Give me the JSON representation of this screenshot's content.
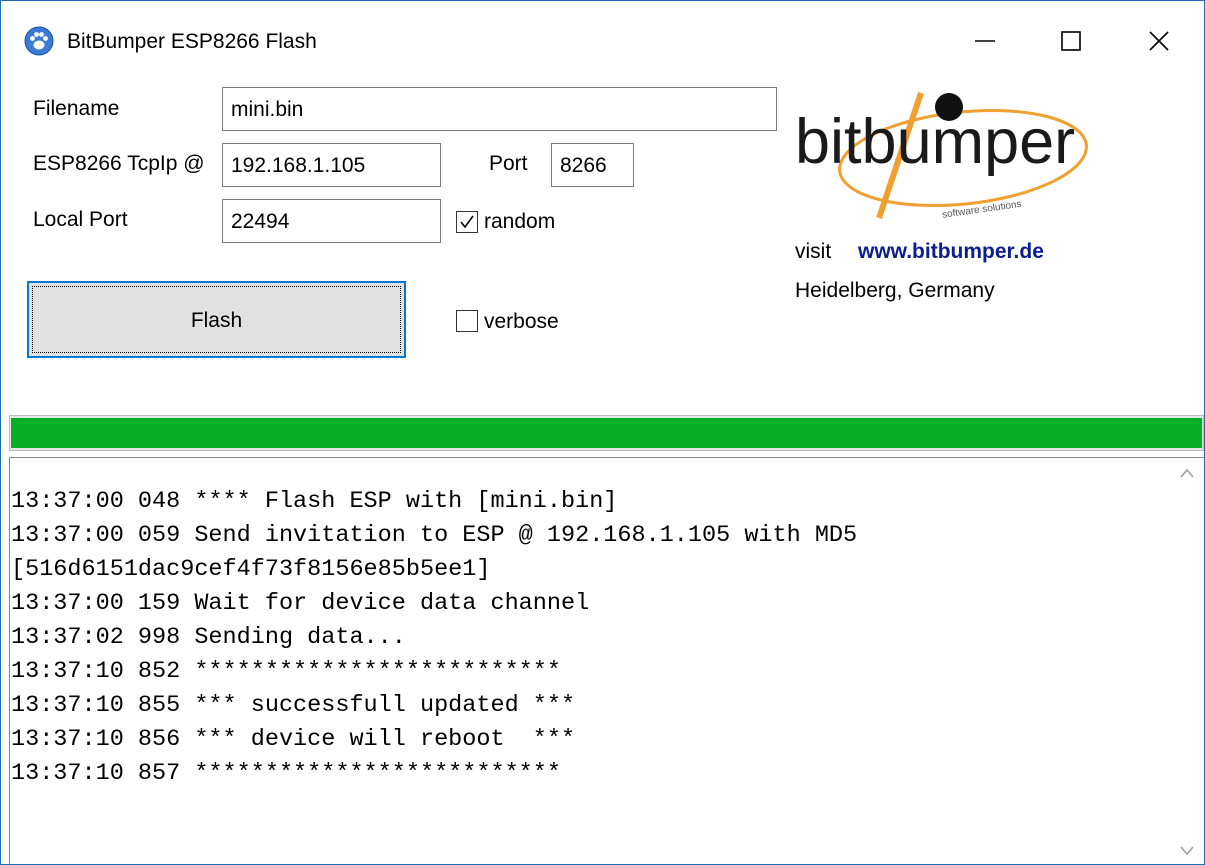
{
  "window": {
    "title": "BitBumper ESP8266 Flash"
  },
  "form": {
    "filename_label": "Filename",
    "filename_value": "mini.bin",
    "ip_label": "ESP8266 TcpIp @",
    "ip_value": "192.168.1.105",
    "port_label": "Port",
    "port_value": "8266",
    "local_port_label": "Local Port",
    "local_port_value": "22494",
    "random_label": "random",
    "random_checked": true,
    "verbose_label": "verbose",
    "verbose_checked": false,
    "flash_button_label": "Flash"
  },
  "branding": {
    "logo_text": "bitbumper",
    "logo_tagline": "software solutions",
    "visit_label": "visit",
    "url": "www.bitbumper.de",
    "location": "Heidelberg, Germany",
    "colors": {
      "logo_text": "#1a1a1a",
      "orbit": "#f0a030",
      "url": "#0a1e8f"
    }
  },
  "progress": {
    "value_percent": 100,
    "color": "#06b025"
  },
  "log": {
    "lines": [
      "13:37:00 048 **** Flash ESP with [mini.bin]",
      "13:37:00 059 Send invitation to ESP @ 192.168.1.105 with MD5",
      "[516d6151dac9cef4f73f8156e85b5ee1]",
      "13:37:00 159 Wait for device data channel",
      "13:37:02 998 Sending data...",
      "13:37:10 852 **************************",
      "13:37:10 855 *** successfull updated ***",
      "13:37:10 856 *** device will reboot  ***",
      "13:37:10 857 **************************"
    ]
  },
  "icons": {
    "app": "paw-icon",
    "minimize": "minimize-icon",
    "maximize": "maximize-icon",
    "close": "close-icon",
    "scroll_up": "chevron-up-icon",
    "scroll_down": "chevron-down-icon"
  }
}
